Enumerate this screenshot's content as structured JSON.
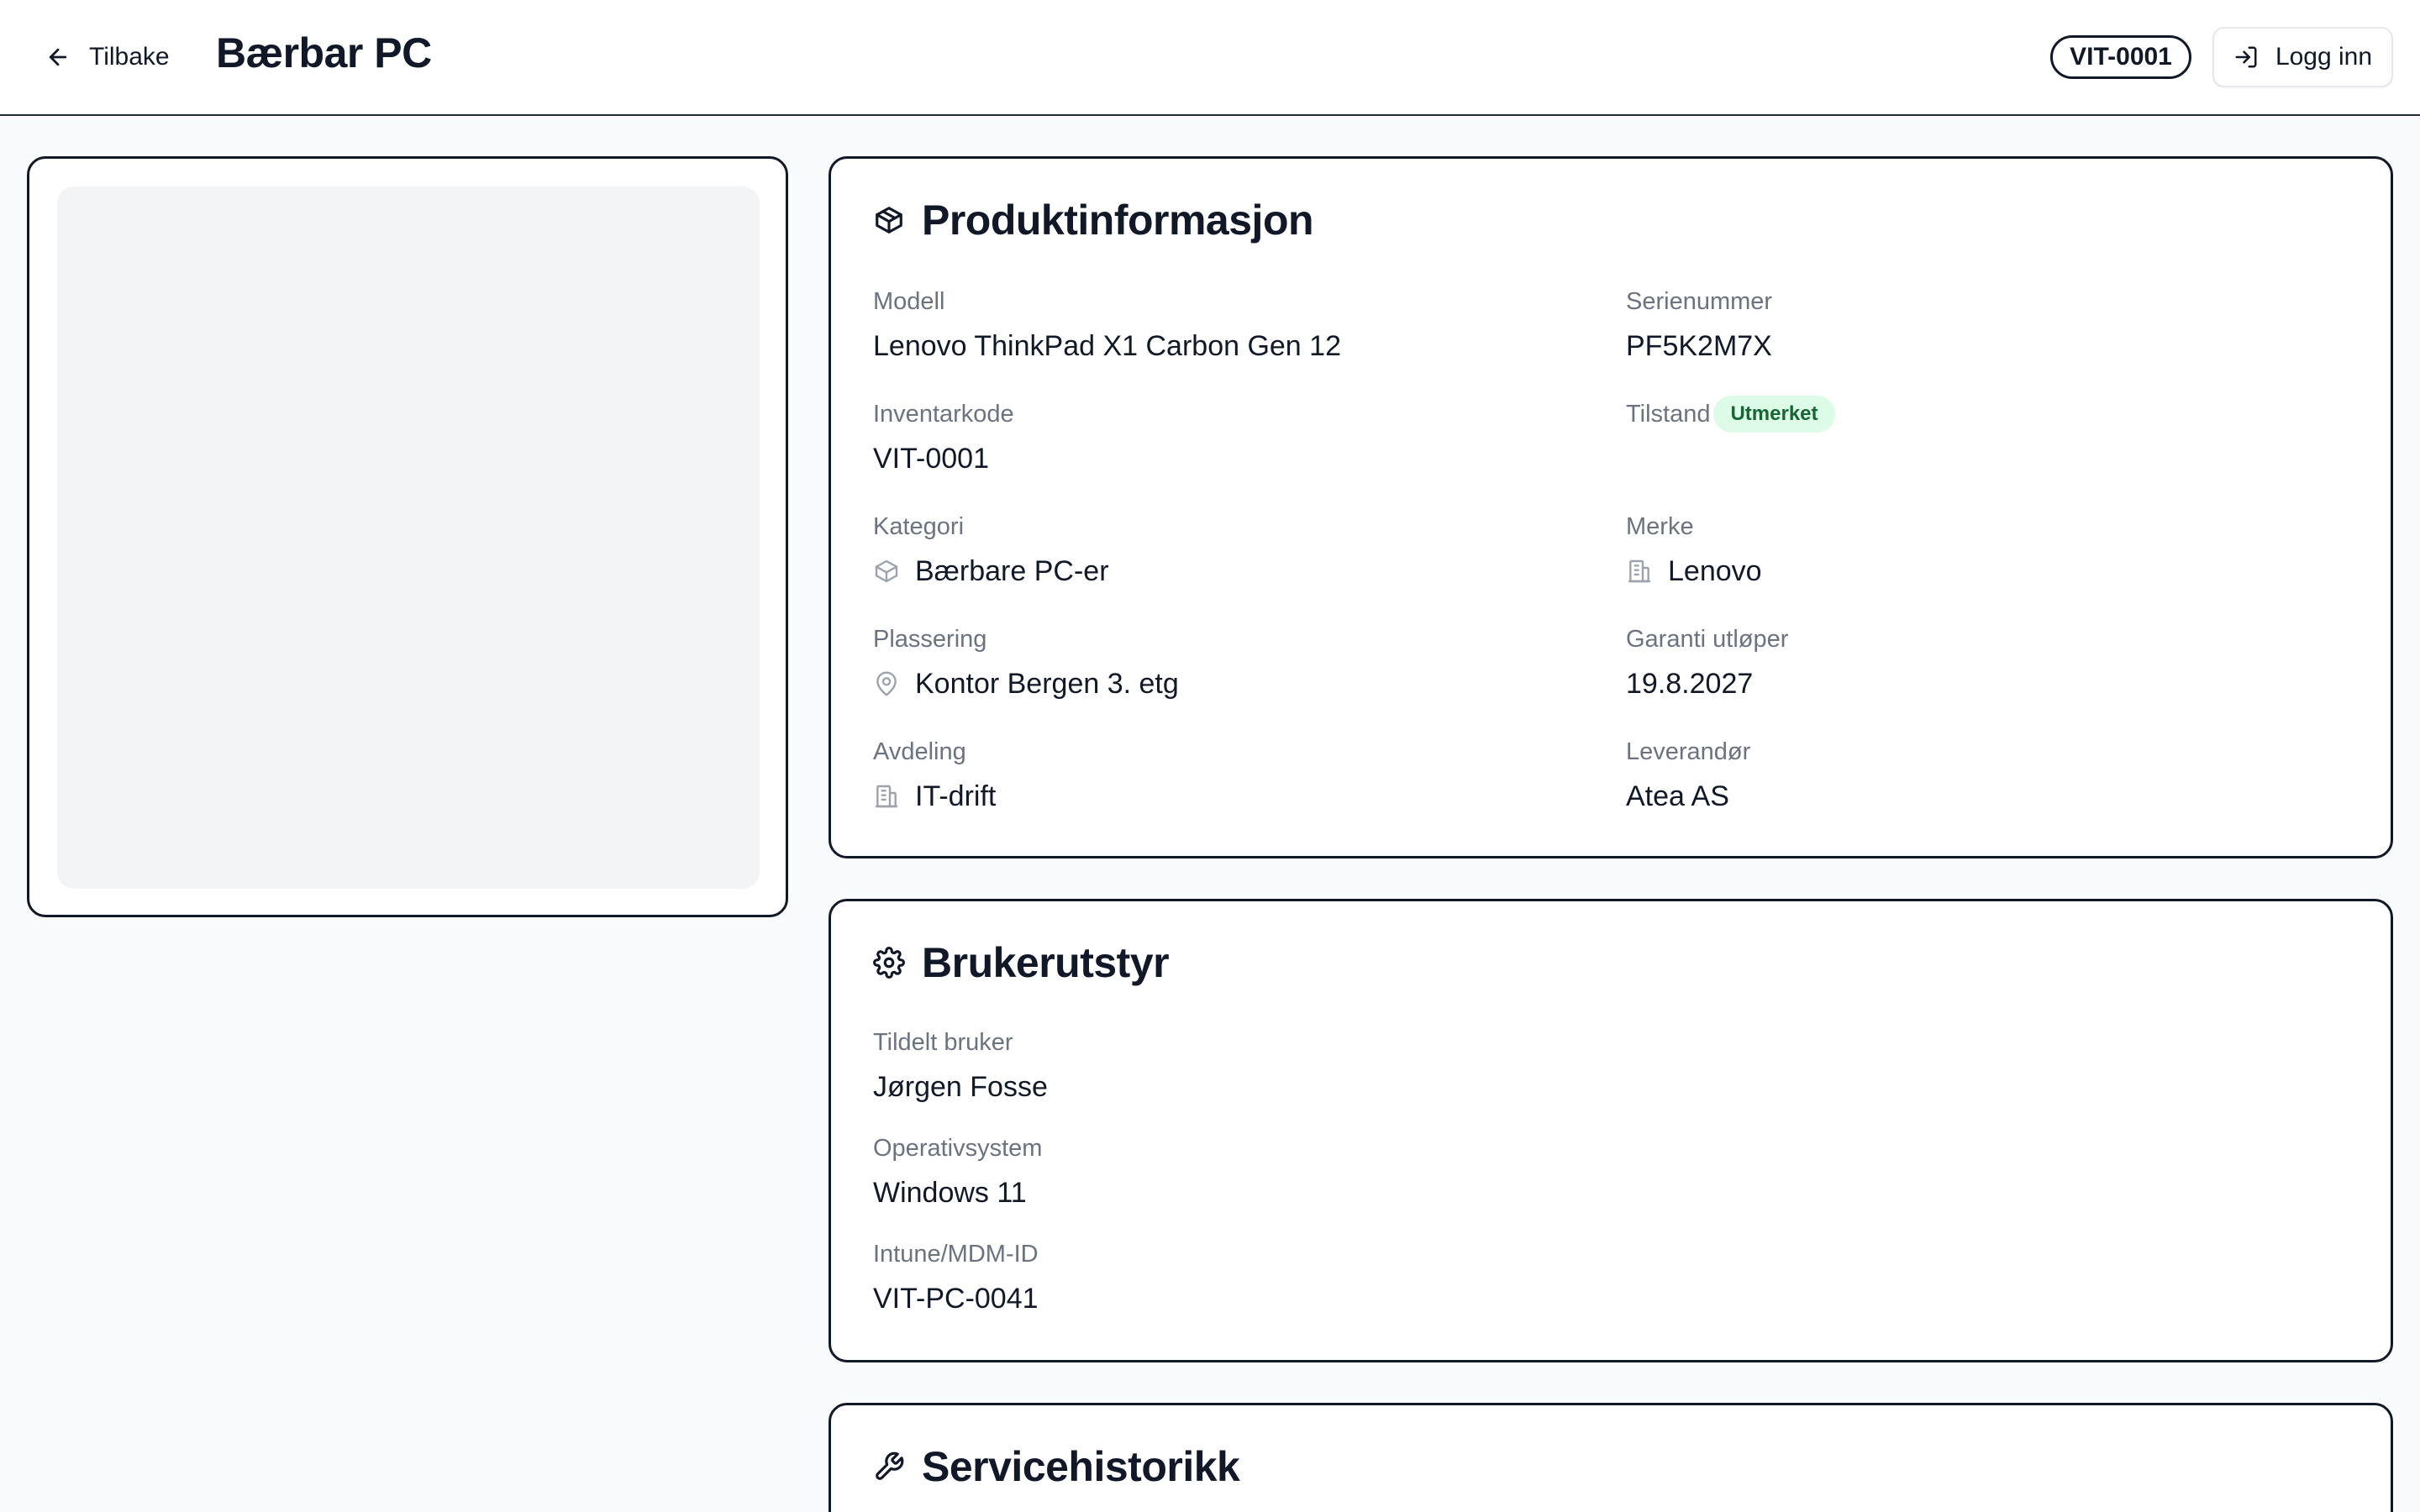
{
  "header": {
    "back_label": "Tilbake",
    "title": "Bærbar PC",
    "code": "VIT-0001",
    "login_label": "Logg inn"
  },
  "product_info": {
    "title": "Produktinformasjon",
    "model_label": "Modell",
    "model_value": "Lenovo ThinkPad X1 Carbon Gen 12",
    "serial_label": "Serienummer",
    "serial_value": "PF5K2M7X",
    "inventory_label": "Inventarkode",
    "inventory_value": "VIT-0001",
    "condition_label": "Tilstand",
    "condition_value": "Utmerket",
    "category_label": "Kategori",
    "category_value": "Bærbare PC-er",
    "brand_label": "Merke",
    "brand_value": "Lenovo",
    "location_label": "Plassering",
    "location_value": "Kontor Bergen 3. etg",
    "warranty_label": "Garanti utløper",
    "warranty_value": "19.8.2027",
    "department_label": "Avdeling",
    "department_value": "IT-drift",
    "supplier_label": "Leverandør",
    "supplier_value": "Atea AS"
  },
  "user_equipment": {
    "title": "Brukerutstyr",
    "assigned_label": "Tildelt bruker",
    "assigned_value": "Jørgen Fosse",
    "os_label": "Operativsystem",
    "os_value": "Windows 11",
    "mdm_label": "Intune/MDM-ID",
    "mdm_value": "VIT-PC-0041"
  },
  "service_history": {
    "title": "Servicehistorikk"
  },
  "colors": {
    "badge_good_bg": "#dcfce7",
    "badge_good_text": "#166534",
    "border": "#111827",
    "muted_text": "#6b7280"
  },
  "icons": {
    "back": "arrow-left-icon",
    "login": "log-in-icon",
    "product": "package-icon",
    "user_equipment": "settings-gear-icon",
    "service": "wrench-icon",
    "category": "package-icon",
    "brand": "building-icon",
    "location": "map-pin-icon",
    "department": "building-icon"
  }
}
